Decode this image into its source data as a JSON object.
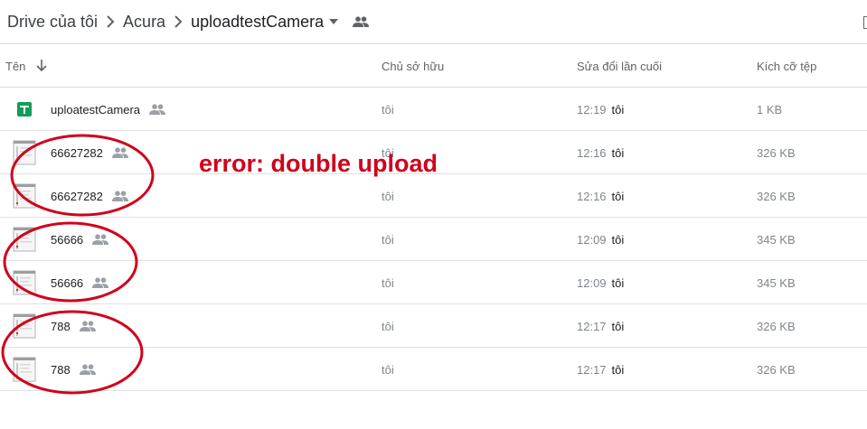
{
  "breadcrumb": {
    "items": [
      "Drive của tôi",
      "Acura",
      "uploadtestCamera"
    ]
  },
  "columns": {
    "name": "Tên",
    "owner": "Chủ sở hữu",
    "modified": "Sửa đổi lần cuối",
    "size": "Kích cỡ tệp"
  },
  "files": [
    {
      "name": "uploatestCamera",
      "owner": "tôi",
      "time": "12:19",
      "by": "tôi",
      "size": "1 KB",
      "type": "sheet-icon"
    },
    {
      "name": "66627282",
      "owner": "tôi",
      "time": "12:16",
      "by": "tôi",
      "size": "326 KB",
      "type": "image-file-icon"
    },
    {
      "name": "66627282",
      "owner": "tôi",
      "time": "12:16",
      "by": "tôi",
      "size": "326 KB",
      "type": "image-file-icon"
    },
    {
      "name": "56666",
      "owner": "tôi",
      "time": "12:09",
      "by": "tôi",
      "size": "345 KB",
      "type": "image-file-icon"
    },
    {
      "name": "56666",
      "owner": "tôi",
      "time": "12:09",
      "by": "tôi",
      "size": "345 KB",
      "type": "image-file-icon"
    },
    {
      "name": "788",
      "owner": "tôi",
      "time": "12:17",
      "by": "tôi",
      "size": "326 KB",
      "type": "image-file-icon"
    },
    {
      "name": "788",
      "owner": "tôi",
      "time": "12:17",
      "by": "tôi",
      "size": "326 KB",
      "type": "image-file-icon"
    }
  ],
  "annotation": {
    "text": "error: double upload",
    "color": "#d0021b"
  },
  "colors": {
    "sheet_green": "#0f9d58",
    "annotation_red": "#d0021b",
    "secondary_text": "#80868b",
    "divider": "#e0e0e0"
  }
}
